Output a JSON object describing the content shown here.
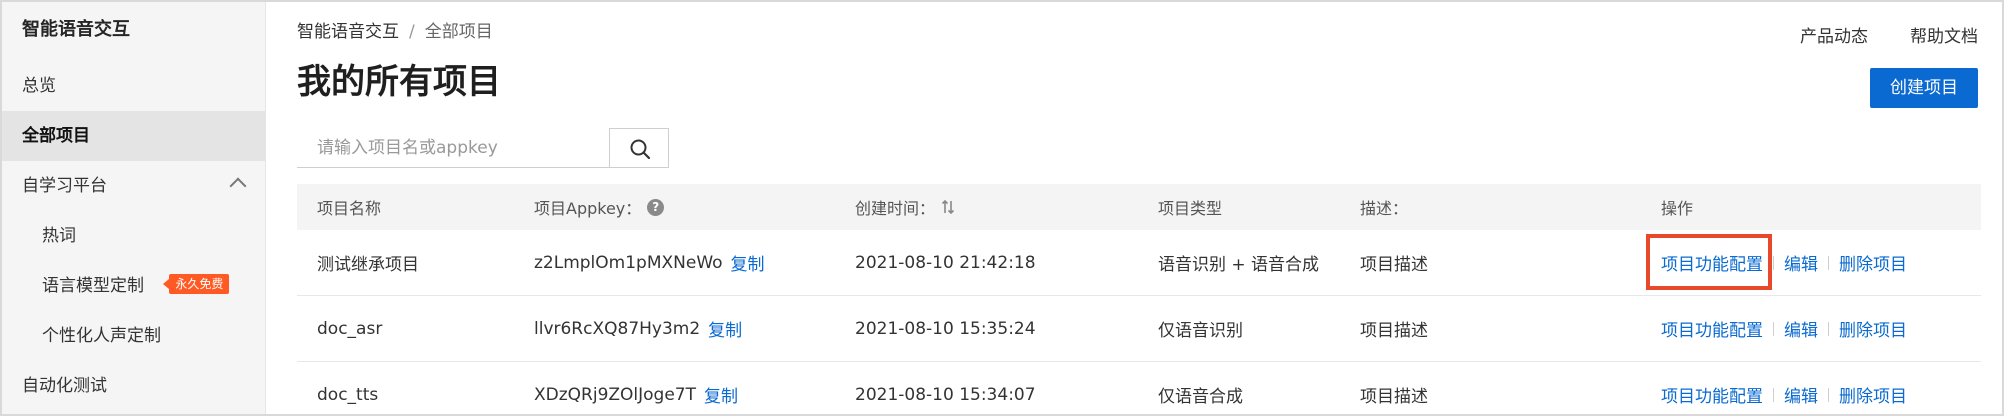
{
  "sidebar": {
    "title": "智能语音交互",
    "items": [
      {
        "label": "总览",
        "active": false
      },
      {
        "label": "全部项目",
        "active": true
      },
      {
        "label": "自学习平台",
        "active": false
      },
      {
        "label": "热词",
        "active": false
      },
      {
        "label": "语言模型定制",
        "active": false,
        "badge": "永久免费"
      },
      {
        "label": "个性化人声定制",
        "active": false
      },
      {
        "label": "自动化测试",
        "active": false
      }
    ]
  },
  "breadcrumb": {
    "root": "智能语音交互",
    "separator": "/",
    "current": "全部项目"
  },
  "top_links": {
    "product_news": "产品动态",
    "help_docs": "帮助文档"
  },
  "page": {
    "title": "我的所有项目",
    "create_button": "创建项目"
  },
  "search": {
    "placeholder": "请输入项目名或appkey"
  },
  "table": {
    "headers": {
      "name": "项目名称",
      "appkey": "项目Appkey：",
      "created": "创建时间：",
      "type": "项目类型",
      "desc": "描述：",
      "ops": "操作"
    },
    "rows": [
      {
        "name": "测试继承项目",
        "appkey": "z2LmplOm1pMXNeWo",
        "copy": "复制",
        "created": "2021-08-10 21:42:18",
        "type": "语音识别 + 语音合成",
        "desc": "项目描述",
        "op_config": "项目功能配置",
        "op_edit": "编辑",
        "op_delete": "删除项目"
      },
      {
        "name": "doc_asr",
        "appkey": "llvr6RcXQ87Hy3m2",
        "copy": "复制",
        "created": "2021-08-10 15:35:24",
        "type": "仅语音识别",
        "desc": "项目描述",
        "op_config": "项目功能配置",
        "op_edit": "编辑",
        "op_delete": "删除项目"
      },
      {
        "name": "doc_tts",
        "appkey": "XDzQRj9ZOlJoge7T",
        "copy": "复制",
        "created": "2021-08-10 15:34:07",
        "type": "仅语音合成",
        "desc": "项目描述",
        "op_config": "项目功能配置",
        "op_edit": "编辑",
        "op_delete": "删除项目"
      }
    ]
  },
  "colors": {
    "accent": "#0a6ad1",
    "badge": "#ff5a24",
    "highlight": "#e8492b"
  }
}
